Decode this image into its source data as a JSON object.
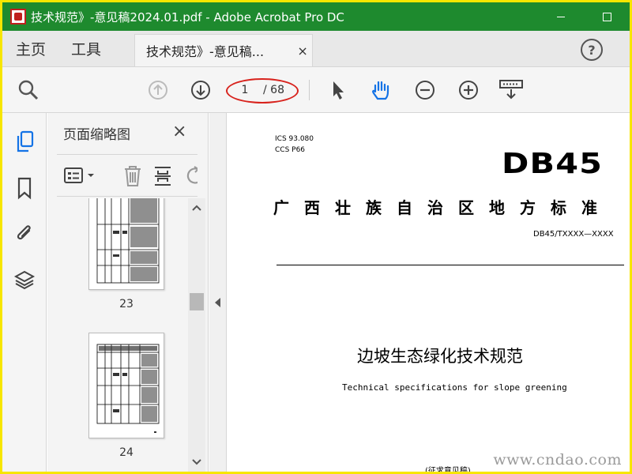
{
  "window": {
    "title": "技术规范》-意见稿2024.01.pdf - Adobe Acrobat Pro DC"
  },
  "tabs": {
    "home": "主页",
    "tools": "工具",
    "document": "技术规范》-意见稿...",
    "close": "×"
  },
  "help": {
    "label": "?"
  },
  "toolbar": {
    "current_page": "1",
    "total_pages": "/ 68",
    "icons": [
      "search-icon",
      "page-up-icon",
      "page-down-icon",
      "select-arrow-icon",
      "hand-tool-icon",
      "zoom-out-icon",
      "zoom-in-icon",
      "keyboard-icon"
    ],
    "accent": "#1473e6",
    "highlight_color": "#d8231d"
  },
  "leftrail": {
    "icons": [
      "page-thumbnails-icon",
      "bookmarks-icon",
      "attachments-icon",
      "layers-icon"
    ]
  },
  "thumbpanel": {
    "title": "页面缩略图",
    "close": "×",
    "thumbnails": [
      {
        "label": "23"
      },
      {
        "label": "24"
      }
    ]
  },
  "document": {
    "ics_line": "ICS  93.080",
    "ccs_line": "CCS  P66",
    "std_code": "DB45",
    "std_title": "广西壮族自治区地方标准",
    "std_number": "DB45/TXXXX—XXXX",
    "title_cn": "边坡生态绿化技术规范",
    "title_en": "Technical specifications for slope greening",
    "draft_note": "(征求意见稿)"
  },
  "watermark": "www.cndao.com",
  "colors": {
    "titlebar": "#1e8a2e",
    "border": "#f7e600"
  }
}
